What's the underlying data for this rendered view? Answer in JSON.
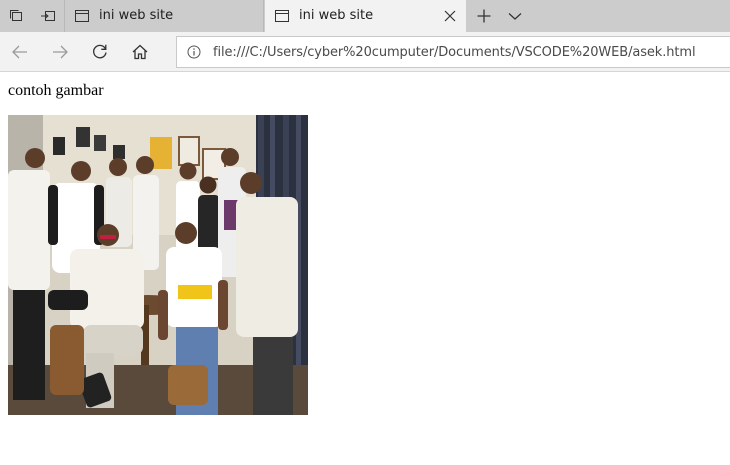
{
  "browser": {
    "tabs": [
      {
        "title": "ini web site",
        "active": false
      },
      {
        "title": "ini web site",
        "active": true
      }
    ],
    "address": "file:///C:/Users/cyber%20cumputer/Documents/VSCODE%20WEB/asek.html",
    "icons": {
      "tab_actions": "tab-set-aside-icon",
      "back_tabs": "tabs-aside-icon",
      "page": "page-icon",
      "close": "close-icon",
      "new_tab": "plus-icon",
      "tab_list": "chevron-down-icon",
      "back": "back-arrow-icon",
      "forward": "forward-arrow-icon",
      "refresh": "refresh-icon",
      "home": "home-icon",
      "info": "info-icon"
    }
  },
  "page": {
    "paragraph": "contoh gambar",
    "image_alt": "group photo of young men posing in a cafe"
  },
  "colors": {
    "tabstrip": "#cccccc",
    "active_tab": "#f2f2f2",
    "page_bg": "#ffffff"
  }
}
